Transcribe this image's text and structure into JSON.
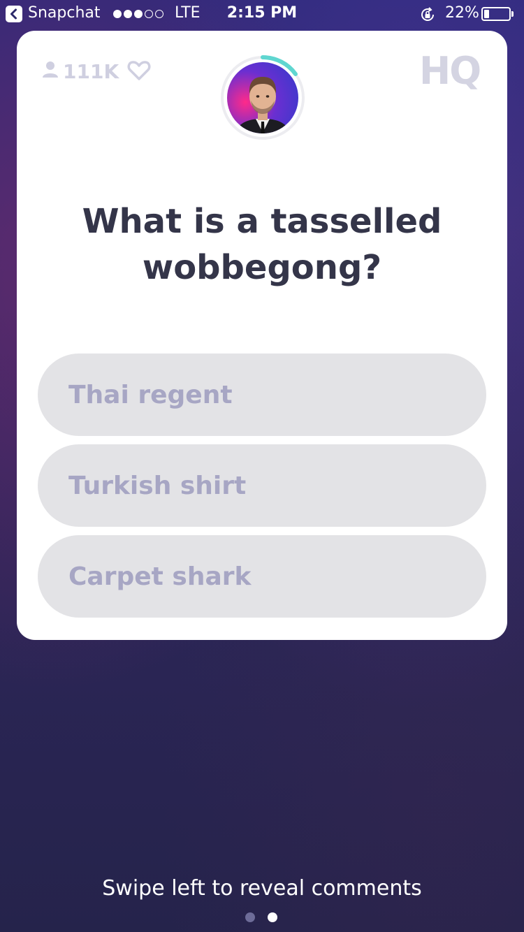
{
  "status_bar": {
    "back_app": "Snapchat",
    "signal_filled": 3,
    "signal_total": 5,
    "network": "LTE",
    "time": "2:15 PM",
    "battery_percent_label": "22%",
    "battery_level": 0.22
  },
  "game": {
    "viewer_count": "111K",
    "logo": "HQ",
    "timer_progress": 0.15,
    "question": "What is a tasselled wobbegong?",
    "answers": [
      {
        "label": "Thai regent"
      },
      {
        "label": "Turkish shirt"
      },
      {
        "label": "Carpet shark"
      }
    ]
  },
  "footer": {
    "hint": "Swipe left to reveal comments",
    "page_count": 2,
    "active_page": 2
  },
  "colors": {
    "accent_timer": "#5fd6d0",
    "question_text": "#343549",
    "answer_bg": "#e3e3e6",
    "answer_text": "#a7a6c4"
  },
  "icons": [
    "back-arrow-icon",
    "rotation-lock-icon",
    "battery-icon",
    "person-icon",
    "heart-icon",
    "host-avatar"
  ]
}
